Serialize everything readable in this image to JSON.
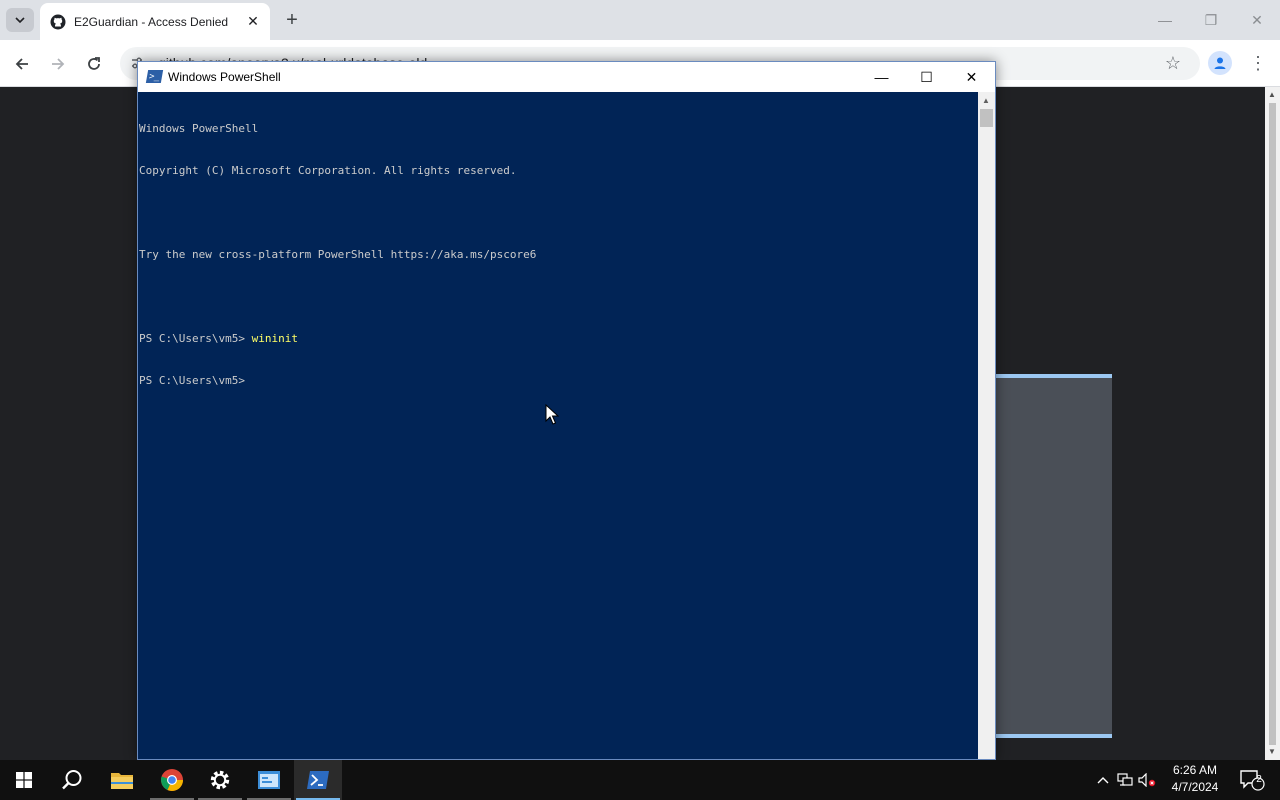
{
  "browser": {
    "tab": {
      "title": "E2Guardian - Access Denied",
      "close": "✕"
    },
    "new_tab": "+",
    "address_bar": {
      "url": "github.com/apoorva3.x/mal-urldatabase-old"
    },
    "window_controls": {
      "minimize": "—",
      "restore": "❐",
      "close": "✕"
    }
  },
  "powershell": {
    "title": "Windows PowerShell",
    "controls": {
      "minimize": "—",
      "maximize": "☐",
      "close": "✕"
    },
    "console_lines": [
      {
        "text": "Windows PowerShell",
        "cmd": ""
      },
      {
        "text": "Copyright (C) Microsoft Corporation. All rights reserved.",
        "cmd": ""
      },
      {
        "text": "",
        "cmd": ""
      },
      {
        "text": "Try the new cross-platform PowerShell https://aka.ms/pscore6",
        "cmd": ""
      },
      {
        "text": "",
        "cmd": ""
      },
      {
        "text": "PS C:\\Users\\vm5> ",
        "cmd": "wininit"
      },
      {
        "text": "PS C:\\Users\\vm5> ",
        "cmd": ""
      }
    ]
  },
  "taskbar": {
    "items": [
      "start-icon",
      "search-icon",
      "file-explorer-icon",
      "chrome-icon",
      "settings-icon",
      "control-panel-icon",
      "powershell-icon"
    ],
    "clock": {
      "time": "6:26 AM",
      "date": "4/7/2024"
    },
    "notification_count": "2"
  },
  "colors": {
    "console_bg": "#012456",
    "console_text": "#cccccc",
    "command_text": "#ffff66",
    "taskbar_bg": "#101010",
    "accent": "#76b9ed"
  }
}
